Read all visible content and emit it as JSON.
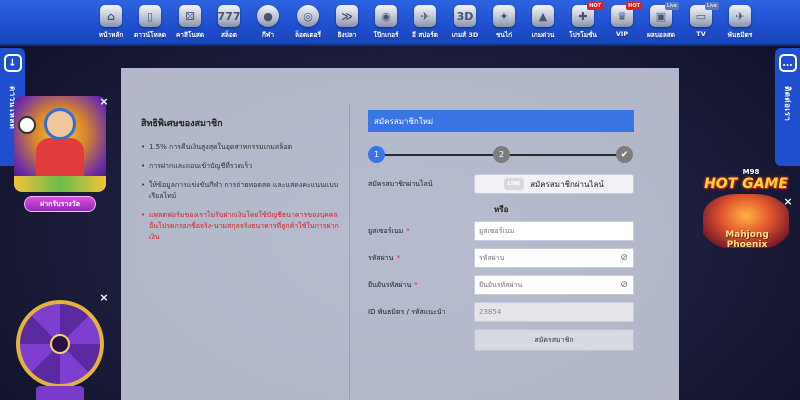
{
  "nav": {
    "items": [
      {
        "label": "หน้าหลัก",
        "icon": "home-icon",
        "glyph": "⌂"
      },
      {
        "label": "ดาวน์โหลด",
        "icon": "phone-icon",
        "glyph": "▯"
      },
      {
        "label": "คาสิโนสด",
        "icon": "dice-icon",
        "glyph": "⚄"
      },
      {
        "label": "สล็อต",
        "icon": "slot-icon",
        "glyph": "777"
      },
      {
        "label": "กีฬา",
        "icon": "ball-icon",
        "glyph": "●"
      },
      {
        "label": "ล็อตเตอรี่",
        "icon": "lottery-icon",
        "glyph": "◎"
      },
      {
        "label": "ยิงปลา",
        "icon": "fish-icon",
        "glyph": "≫"
      },
      {
        "label": "โป๊กเกอร์",
        "icon": "poker-icon",
        "glyph": "◉"
      },
      {
        "label": "อี สปอร์ต",
        "icon": "esport-icon",
        "glyph": "✈"
      },
      {
        "label": "เกมส์ 3D",
        "icon": "3d-icon",
        "glyph": "3D"
      },
      {
        "label": "ชนไก่",
        "icon": "rooster-icon",
        "glyph": "✦"
      },
      {
        "label": "เกมด่วน",
        "icon": "rocket-icon",
        "glyph": "▲"
      },
      {
        "label": "โปรโมชั่น",
        "icon": "gift-icon",
        "glyph": "✚",
        "badge": "HOT"
      },
      {
        "label": "VIP",
        "icon": "vip-icon",
        "glyph": "♛",
        "badge": "HOT"
      },
      {
        "label": "ผลบอลสด",
        "icon": "live-score-icon",
        "glyph": "▣",
        "live": "Live"
      },
      {
        "label": "TV",
        "icon": "tv-icon",
        "glyph": "▭",
        "live": "Live"
      },
      {
        "label": "พันธมิตร",
        "icon": "partner-icon",
        "glyph": "✈"
      }
    ]
  },
  "side": {
    "left_label": "ดาวน์โหลด",
    "left_icon": "download-icon",
    "right_label": "ติดต่อเรา",
    "right_icon": "chat-icon"
  },
  "promo": {
    "left_cta": "ฝากรับรางวัล",
    "right_brand": "M98",
    "right_hot": "HOT GAME",
    "right_title": "Mahjong Phoenix"
  },
  "benefits": {
    "title": "สิทธิพิเศษของสมาชิก",
    "items": [
      "1.5% การคืนเงินสูงสุดในอุตสาหกรรมเกมสล็อต",
      "การฝากและถอนเข้าบัญชีที่รวดเร็ว",
      "ให้ข้อมูลการแข่งขันกีฬา การถ่ายทอดสด และแสดงคะแนนแบบเรียลไทม์"
    ],
    "warning": "แพลตฟอร์มของเราไม่รับฝากเงินโดยใช้บัญชีธนาคารของบุคคลอื่นโปรดกรอกชื่อจริง-นามสกุลจริงธนาคารที่ลูกค้าใช้ในการฝากเงิน"
  },
  "form": {
    "header": "สมัครสมาชิกใหม่",
    "steps": [
      "1",
      "2",
      "✔"
    ],
    "line_label": "สมัครสมาชิกผ่านไลน์",
    "line_button": "สมัครสมาชิกผ่านไลน์",
    "line_icon_text": "LINE",
    "or": "หรือ",
    "username_label": "ยูสเซอร์เนม",
    "username_placeholder": "ยูสเซอร์เนม",
    "password_label": "รหัสผ่าน",
    "password_placeholder": "รหัสผ่าน",
    "confirm_label": "ยืนยันรหัสผ่าน",
    "confirm_placeholder": "ยืนยันรหัสผ่าน",
    "partner_label": "ID พันธมิตร / รหัสแนะนำ",
    "partner_value": "23854",
    "required_mark": "*",
    "submit": "สมัครสมาชิก"
  }
}
